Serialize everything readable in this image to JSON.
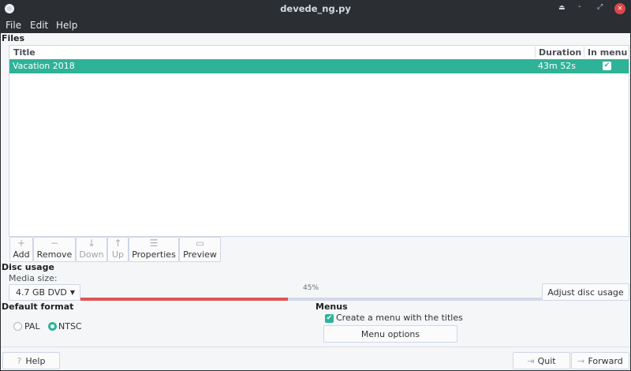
{
  "window": {
    "title": "devede_ng.py"
  },
  "menubar": [
    "File",
    "Edit",
    "Help"
  ],
  "files": {
    "label": "Files",
    "columns": [
      "Title",
      "Duration",
      "In menu"
    ],
    "rows": [
      {
        "title": "Vacation 2018",
        "duration": "43m 52s",
        "in_menu": true
      }
    ]
  },
  "toolbar": {
    "add": "Add",
    "remove": "Remove",
    "down": "Down",
    "up": "Up",
    "properties": "Properties",
    "preview": "Preview"
  },
  "disc": {
    "label": "Disc usage",
    "media_label": "Media size:",
    "media_value": "4.7 GB DVD",
    "usage_percent": 45,
    "usage_text": "45%",
    "adjust": "Adjust disc usage"
  },
  "format": {
    "label": "Default format",
    "pal": "PAL",
    "ntsc": "NTSC",
    "selected": "NTSC"
  },
  "menus": {
    "label": "Menus",
    "create_menu": "Create a menu with the titles",
    "create_checked": true,
    "options": "Menu options"
  },
  "footer": {
    "help": "Help",
    "quit": "Quit",
    "forward": "Forward"
  },
  "colors": {
    "accent": "#2eb398",
    "progress": "#e05555",
    "track": "#d3d9e6"
  }
}
